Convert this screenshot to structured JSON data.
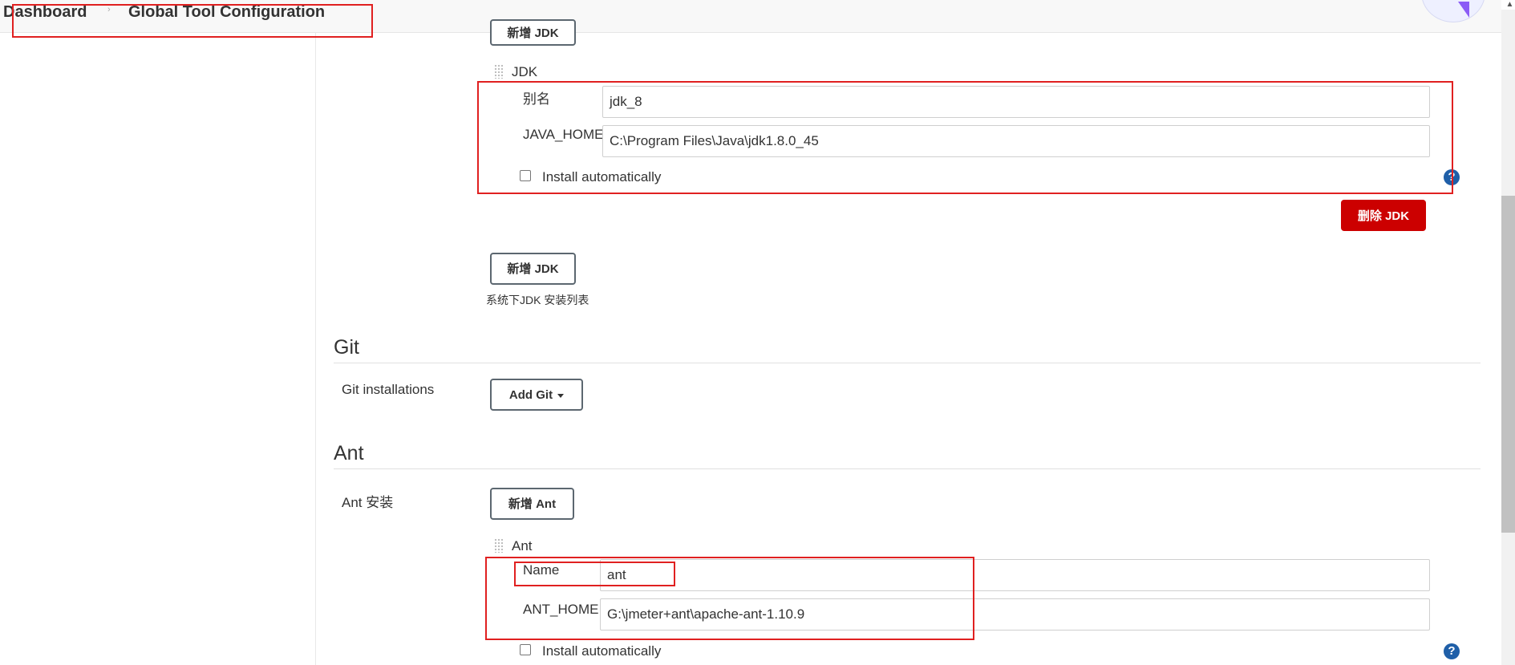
{
  "breadcrumb": {
    "dashboard": "Dashboard",
    "separator": "›",
    "current": "Global Tool Configuration"
  },
  "jdk": {
    "add_button_top": "新增 JDK",
    "installation_title": "JDK",
    "alias_label": "别名",
    "alias_value": "jdk_8",
    "java_home_label": "JAVA_HOME",
    "java_home_value": "C:\\Program Files\\Java\\jdk1.8.0_45",
    "install_auto_label": "Install automatically",
    "install_auto_checked": false,
    "delete_button": "删除 JDK",
    "add_button": "新增 JDK",
    "list_hint": "系统下JDK 安装列表"
  },
  "git": {
    "section_title": "Git",
    "installations_label": "Git installations",
    "add_button": "Add Git"
  },
  "ant": {
    "section_title": "Ant",
    "install_label": "Ant 安装",
    "add_button": "新增 Ant",
    "installation_title": "Ant",
    "name_label": "Name",
    "name_value": "ant",
    "ant_home_label": "ANT_HOME",
    "ant_home_value": "G:\\jmeter+ant\\apache-ant-1.10.9",
    "install_auto_label": "Install automatically",
    "install_auto_checked": false
  },
  "icons": {
    "help": "help-icon",
    "drag": "drag-handle-icon",
    "dropdown": "chevron-down-icon"
  },
  "colors": {
    "annotation_red": "#e02020",
    "danger": "#cc0000",
    "help_blue": "#1f5fa8"
  }
}
